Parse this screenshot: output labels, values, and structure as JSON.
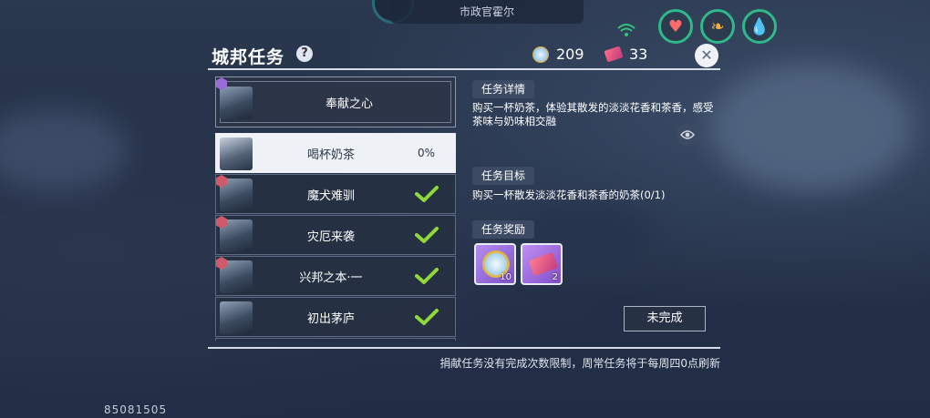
{
  "header": {
    "npc_name": "市政官霍尔"
  },
  "panel": {
    "title": "城邦任务",
    "help_icon": "?",
    "currency": [
      {
        "icon": "coin-icon",
        "value": "209"
      },
      {
        "icon": "ticket-icon",
        "value": "33"
      }
    ],
    "close_icon": "✕"
  },
  "tasks": [
    {
      "label": "奉献之心",
      "featured": true,
      "badge": "purple"
    },
    {
      "label": "喝杯奶茶",
      "selected": true,
      "progress": "0%"
    },
    {
      "label": "魔犬难驯",
      "completed": true,
      "badge": "red"
    },
    {
      "label": "灾厄来袭",
      "completed": true,
      "badge": "red"
    },
    {
      "label": "兴邦之本·一",
      "completed": true,
      "badge": "red"
    },
    {
      "label": "初出茅庐",
      "completed": true
    }
  ],
  "details": {
    "detail_tag": "任务详情",
    "detail_text": "购买一杯奶茶，体验其散发的淡淡花香和茶香，感受茶味与奶味相交融",
    "goal_tag": "任务目标",
    "goal_text": "购买一杯散发淡淡花香和茶香的奶茶(0/1)",
    "reward_tag": "任务奖励",
    "rewards": [
      {
        "icon": "coin-icon",
        "qty": "10"
      },
      {
        "icon": "ticket-icon",
        "qty": "2"
      }
    ],
    "status_button": "未完成"
  },
  "footer": {
    "note": "捐献任务没有完成次数限制，周常任务将于每周四0点刷新",
    "uid": "85081505"
  },
  "colors": {
    "accent_green": "#2fb98a",
    "check_green": "#8fd93a",
    "selected_bg": "#eef1f5"
  }
}
